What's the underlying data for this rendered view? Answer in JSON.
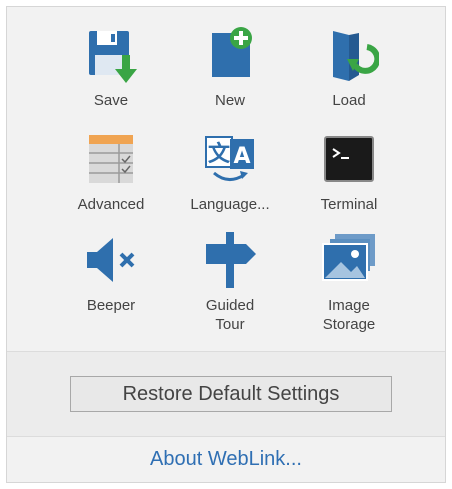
{
  "menu": {
    "items": [
      {
        "id": "save",
        "label": "Save",
        "icon": "save-icon"
      },
      {
        "id": "new",
        "label": "New",
        "icon": "new-document-icon"
      },
      {
        "id": "load",
        "label": "Load",
        "icon": "load-folder-icon"
      },
      {
        "id": "advanced",
        "label": "Advanced",
        "icon": "advanced-settings-icon"
      },
      {
        "id": "language",
        "label": "Language...",
        "icon": "language-icon"
      },
      {
        "id": "terminal",
        "label": "Terminal",
        "icon": "terminal-icon"
      },
      {
        "id": "beeper",
        "label": "Beeper",
        "icon": "speaker-muted-icon"
      },
      {
        "id": "guided_tour",
        "label_line1": "Guided",
        "label_line2": "Tour",
        "icon": "signpost-icon"
      },
      {
        "id": "image_storage",
        "label_line1": "Image",
        "label_line2": "Storage",
        "icon": "image-storage-icon"
      }
    ]
  },
  "restore": {
    "label": "Restore Default Settings"
  },
  "about": {
    "label": "About WebLink..."
  },
  "colors": {
    "icon_blue": "#2f6fad",
    "accent_green": "#3aa545",
    "link_blue": "#2f6fb3",
    "panel_bg": "#f2f2f2"
  }
}
